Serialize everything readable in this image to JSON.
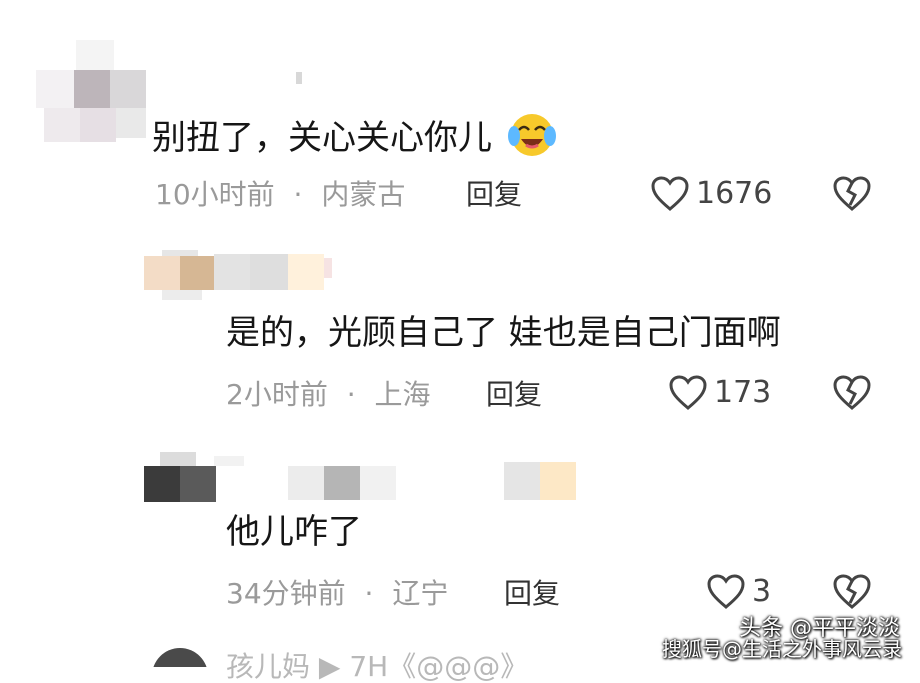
{
  "comments": [
    {
      "text": "别扭了，关心关心你儿",
      "emoji": "laughing-crying-face",
      "time": "10小时前",
      "separator": "·",
      "location": "内蒙古",
      "reply_label": "回复",
      "likes": "1676"
    },
    {
      "text": "是的，光顾自己了 娃也是自己门面啊",
      "time": "2小时前",
      "separator": "·",
      "location": "上海",
      "reply_label": "回复",
      "likes": "173"
    },
    {
      "text": "他儿咋了",
      "time": "34分钟前",
      "separator": "·",
      "location": "辽宁",
      "reply_label": "回复",
      "likes": "3"
    }
  ],
  "partial_next": "孩儿妈 ▶ 7H《@@@》",
  "watermark": {
    "top": "头条 @平平淡淡",
    "bottom": "搜狐号@生活之外事风云录"
  },
  "colors": {
    "text": "#161616",
    "meta": "#9a9a9a",
    "icon": "#444444"
  }
}
